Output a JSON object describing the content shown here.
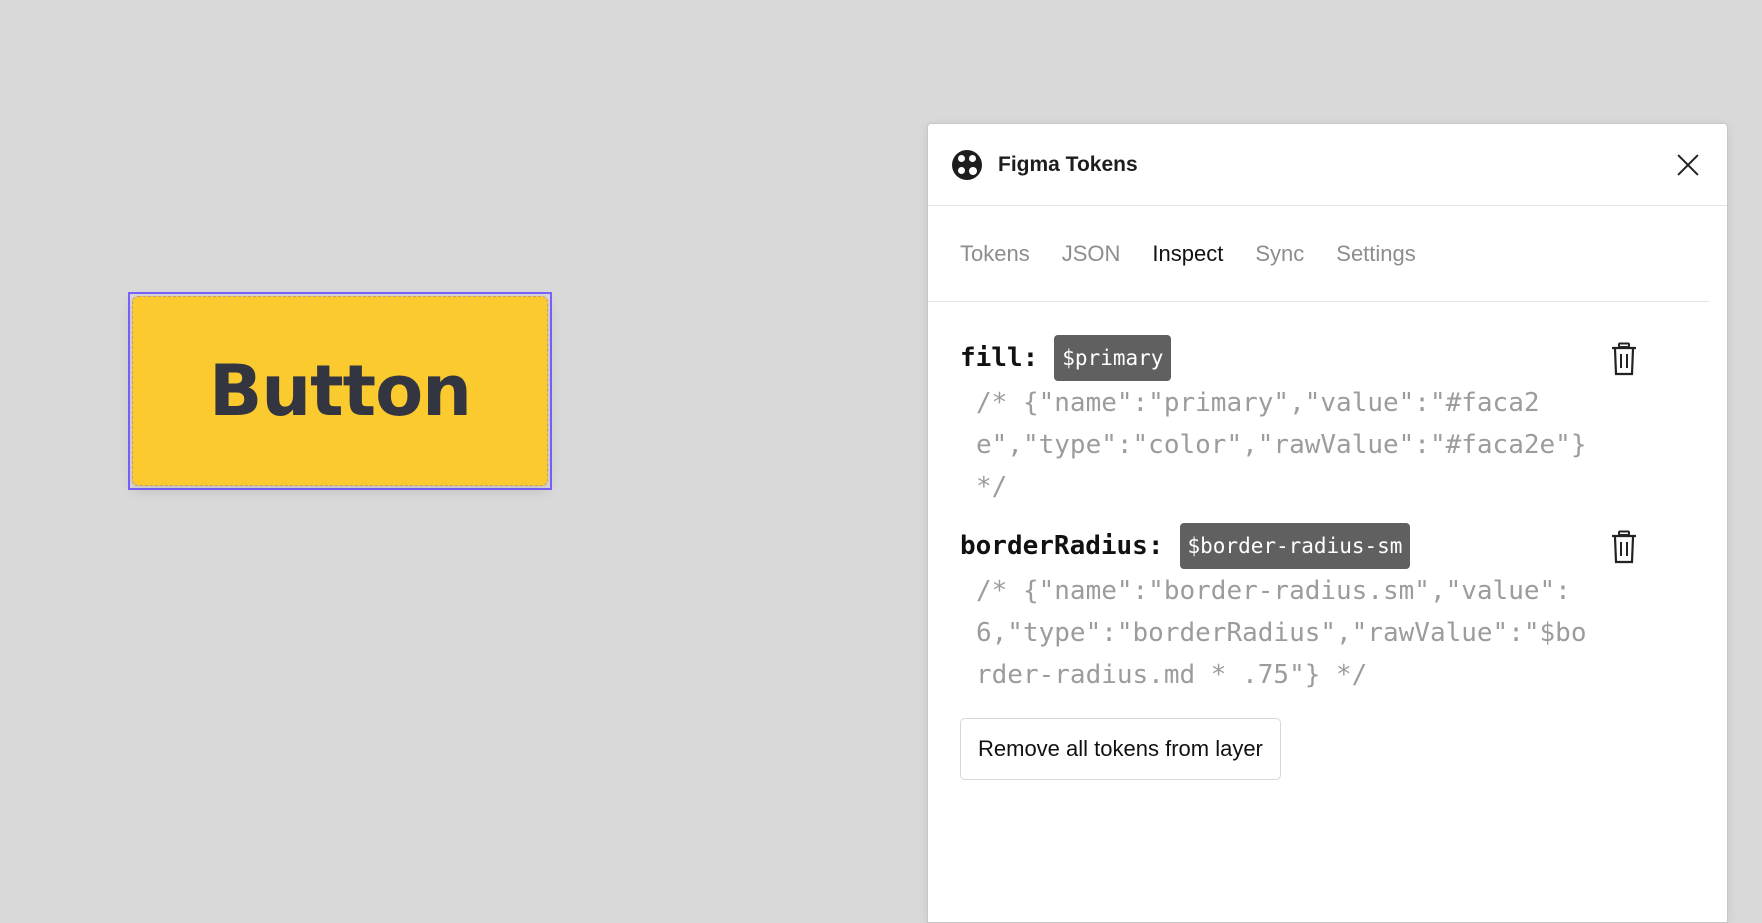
{
  "canvas": {
    "button_text": "Button",
    "button_color": "#fbca2e",
    "selection_color": "#7b61ff"
  },
  "plugin": {
    "title": "Figma Tokens",
    "logo_icon": "figma-tokens-logo-icon",
    "close_icon": "close-icon",
    "tabs": [
      {
        "label": "Tokens"
      },
      {
        "label": "JSON"
      },
      {
        "label": "Inspect",
        "active": true
      },
      {
        "label": "Sync"
      },
      {
        "label": "Settings"
      }
    ],
    "tokens": [
      {
        "property": "fill:",
        "token": "$primary",
        "raw": "/* {\"name\":\"primary\",\"value\":\"#faca2e\",\"type\":\"color\",\"rawValue\":\"#faca2e\"} */"
      },
      {
        "property": "borderRadius:",
        "token": "$border-radius-sm",
        "raw": "/* {\"name\":\"border-radius.sm\",\"value\":6,\"type\":\"borderRadius\",\"rawValue\":\"$border-radius.md * .75\"} */"
      }
    ],
    "delete_icon": "trash-icon",
    "remove_all_label": "Remove all tokens from layer"
  }
}
